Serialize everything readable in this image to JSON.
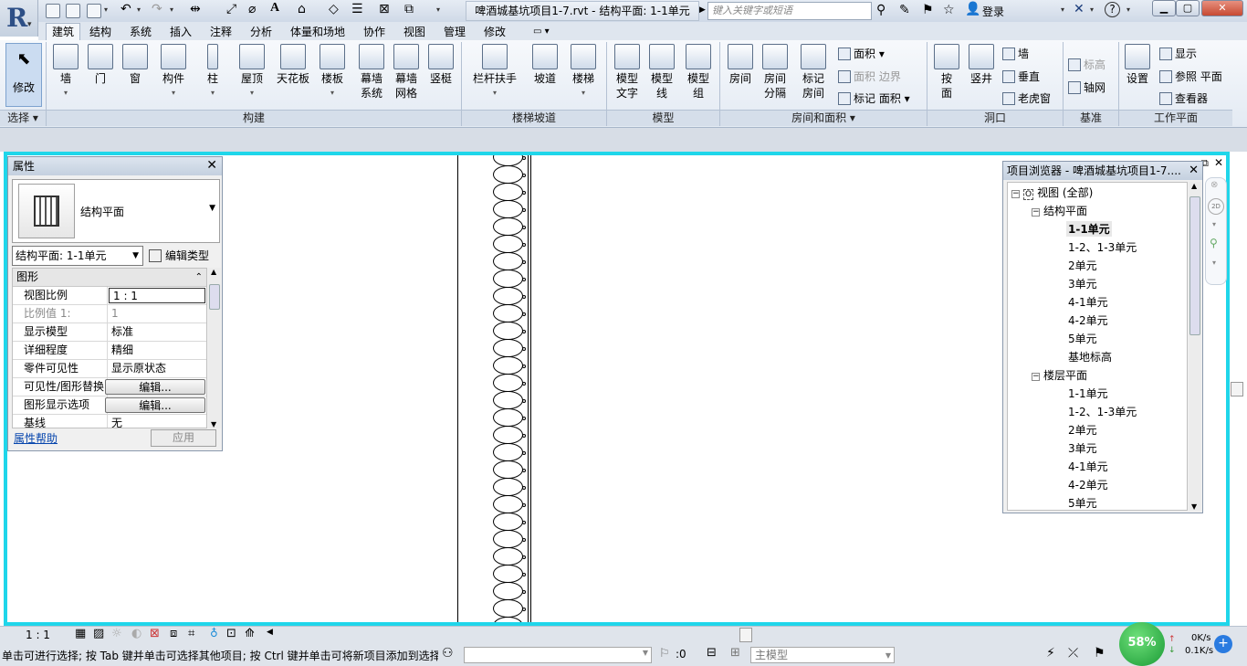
{
  "window": {
    "title": "啤酒城基坑项目1-7.rvt - 结构平面: 1-1单元",
    "search_placeholder": "键入关键字或短语",
    "login_label": "登录",
    "help_icon": "?"
  },
  "tabs": [
    "建筑",
    "结构",
    "系统",
    "插入",
    "注释",
    "分析",
    "体量和场地",
    "协作",
    "视图",
    "管理",
    "修改"
  ],
  "active_tab": "建筑",
  "ribbon": {
    "modify_label": "修改",
    "select_panel": "选择",
    "build_items": [
      "墙",
      "门",
      "窗",
      "构件",
      "柱",
      "屋顶",
      "天花板",
      "楼板",
      "幕墙系统",
      "幕墙网格",
      "竖梃"
    ],
    "build_panel": "构建",
    "stair_items": [
      "栏杆扶手",
      "坡道",
      "楼梯"
    ],
    "stair_panel": "楼梯坡道",
    "model_items": [
      "模型文字",
      "模型线",
      "模型组"
    ],
    "model_panel": "模型",
    "room_items": [
      "房间",
      "房间分隔",
      "标记房间"
    ],
    "room_small": [
      "面积",
      "面积 边界",
      "标记 面积"
    ],
    "room_panel": "房间和面积",
    "opening_items": [
      "按面",
      "竖井"
    ],
    "opening_small": [
      "墙",
      "垂直",
      "老虎窗"
    ],
    "opening_panel": "洞口",
    "datum_small": [
      "标高",
      "轴网"
    ],
    "datum_panel": "基准",
    "work_items": [
      "设置"
    ],
    "work_small": [
      "显示",
      "参照 平面",
      "查看器"
    ],
    "work_panel": "工作平面"
  },
  "properties": {
    "title": "属性",
    "type_name": "结构平面",
    "instance_selector": "结构平面: 1-1单元",
    "edit_type_label": "编辑类型",
    "group_label": "图形",
    "rows": [
      {
        "key": "视图比例",
        "value": "1 : 1"
      },
      {
        "key": "比例值 1:",
        "value": "1"
      },
      {
        "key": "显示模型",
        "value": "标准"
      },
      {
        "key": "详细程度",
        "value": "精细"
      },
      {
        "key": "零件可见性",
        "value": "显示原状态"
      },
      {
        "key": "可见性/图形替换",
        "value": "编辑..."
      },
      {
        "key": "图形显示选项",
        "value": "编辑..."
      },
      {
        "key": "基线",
        "value": "无"
      }
    ],
    "help_link": "属性帮助",
    "apply_label": "应用"
  },
  "browser": {
    "title": "项目浏览器 - 啤酒城基坑项目1-7....",
    "root": "视图 (全部)",
    "group1": "结构平面",
    "group1_items": [
      "1-1单元",
      "1-2、1-3单元",
      "2单元",
      "3单元",
      "4-1单元",
      "4-2单元",
      "5单元",
      "基地标高"
    ],
    "group2": "楼层平面",
    "group2_items": [
      "1-1单元",
      "1-2、1-3单元",
      "2单元",
      "3单元",
      "4-1单元",
      "4-2单元",
      "5单元"
    ],
    "selected_item": "1-1单元"
  },
  "view_bar": {
    "scale": "1 : 1"
  },
  "status": {
    "message": "单击可进行选择; 按 Tab 键并单击可选择其他项目; 按 Ctrl 键并单击可将新项目添加到选择",
    "count": ":0",
    "model_label": "主模型",
    "net_up": "0K/s",
    "net_down": "0.1K/s",
    "perf_badge": "58%"
  }
}
